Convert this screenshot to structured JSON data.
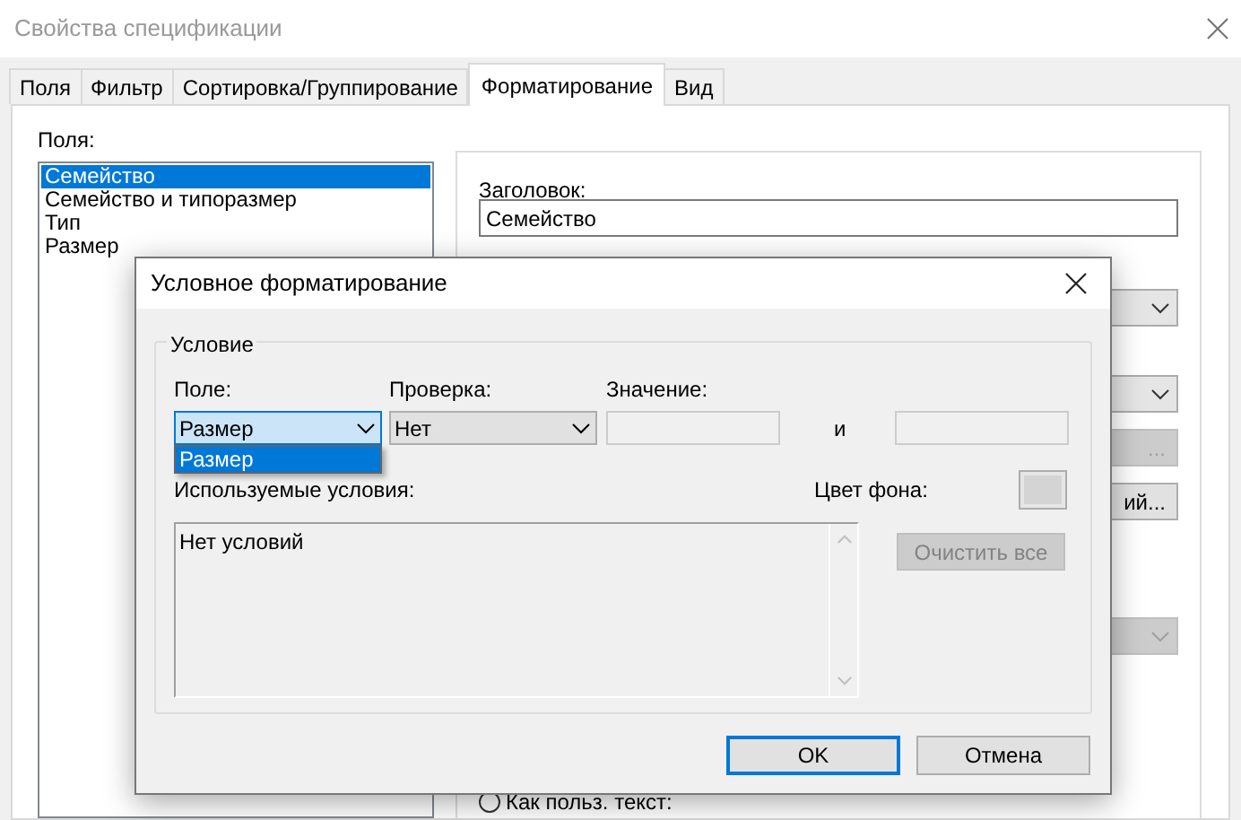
{
  "window": {
    "title": "Свойства спецификации"
  },
  "tabs": [
    {
      "label": "Поля",
      "selected": false
    },
    {
      "label": "Фильтр",
      "selected": false
    },
    {
      "label": "Сортировка/Группирование",
      "selected": false
    },
    {
      "label": "Форматирование",
      "selected": true
    },
    {
      "label": "Вид",
      "selected": false
    }
  ],
  "fields_panel": {
    "label": "Поля:",
    "items": [
      {
        "label": "Семейство",
        "selected": true
      },
      {
        "label": "Семейство и типоразмер",
        "selected": false
      },
      {
        "label": "Тип",
        "selected": false
      },
      {
        "label": "Размер",
        "selected": false
      }
    ]
  },
  "format_panel": {
    "header_label": "Заголовок:",
    "header_value": "Семейство",
    "cut_controls": [
      {
        "kind": "dropdown",
        "disabled": false
      },
      {
        "kind": "dropdown",
        "disabled": false
      },
      {
        "kind": "button",
        "label": "...",
        "disabled": true
      },
      {
        "kind": "button",
        "label": "ий...",
        "disabled": false
      },
      {
        "kind": "dropdown",
        "disabled": true
      }
    ],
    "radio": {
      "label": "Как польз. текст:",
      "selected": false
    }
  },
  "dialog": {
    "title": "Условное форматирование",
    "group_label": "Условие",
    "field_label": "Поле:",
    "field_value": "Размер",
    "field_options": [
      {
        "label": "Размер",
        "selected": true
      }
    ],
    "check_label": "Проверка:",
    "check_value": "Нет",
    "value_label": "Значение:",
    "and_label": "и",
    "used_label": "Используемые условия:",
    "conditions_text": "Нет условий",
    "bg_color_label": "Цвет фона:",
    "clear_button": {
      "label": "Очистить все",
      "disabled": true
    },
    "buttons": [
      {
        "label": "OK",
        "default": true
      },
      {
        "label": "Отмена",
        "default": false
      }
    ]
  }
}
